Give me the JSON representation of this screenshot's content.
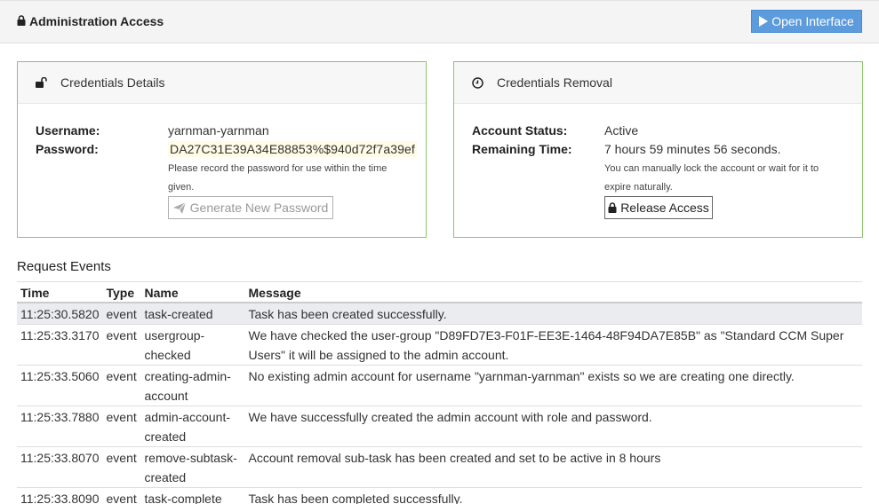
{
  "header": {
    "title": "Administration Access",
    "title_icon": "lock-icon",
    "open_button_label": "Open Interface",
    "open_button_icon": "play-icon"
  },
  "credentials_panel": {
    "title": "Credentials Details",
    "icon": "unlock-icon",
    "username_label": "Username:",
    "username_value": "yarnman-yarnman",
    "password_label": "Password:",
    "password_value": "DA27C31E39A34E88853%$940d72f7a39ef",
    "note": "Please record the password for use within the time given.",
    "generate_button_label": "Generate New Password",
    "generate_button_icon": "paper-plane-icon"
  },
  "removal_panel": {
    "title": "Credentials Removal",
    "icon": "clock-icon",
    "status_label": "Account Status:",
    "status_value": "Active",
    "remaining_label": "Remaining Time:",
    "remaining_value": "7 hours 59 minutes 56 seconds.",
    "note": "You can manually lock the account or wait for it to expire naturally.",
    "release_button_label": "Release Access",
    "release_button_icon": "lock-icon"
  },
  "events": {
    "title": "Request Events",
    "columns": [
      "Time",
      "Type",
      "Name",
      "Message"
    ],
    "rows": [
      {
        "time": "11:25:30.5820",
        "type": "event",
        "name": "task-created",
        "message": "Task has been created successfully."
      },
      {
        "time": "11:25:33.3170",
        "type": "event",
        "name": "usergroup-checked",
        "message": "We have checked the user-group \"D89FD7E3-F01F-EE3E-1464-48F94DA7E85B\" as \"Standard CCM Super Users\" it will be assigned to the admin account."
      },
      {
        "time": "11:25:33.5060",
        "type": "event",
        "name": "creating-admin-account",
        "message": "No existing admin account for username \"yarnman-yarnman\" exists so we are creating one directly."
      },
      {
        "time": "11:25:33.7880",
        "type": "event",
        "name": "admin-account-created",
        "message": "We have successfully created the admin account with role and password."
      },
      {
        "time": "11:25:33.8070",
        "type": "event",
        "name": "remove-subtask-created",
        "message": "Account removal sub-task has been created and set to be active in 8 hours"
      },
      {
        "time": "11:25:33.8090",
        "type": "event",
        "name": "task-complete",
        "message": "Task has been completed successfully."
      }
    ]
  },
  "colors": {
    "panel_border": "#8dc56a",
    "primary_button": "#5d9cdc",
    "password_highlight": "#fffbe5"
  }
}
